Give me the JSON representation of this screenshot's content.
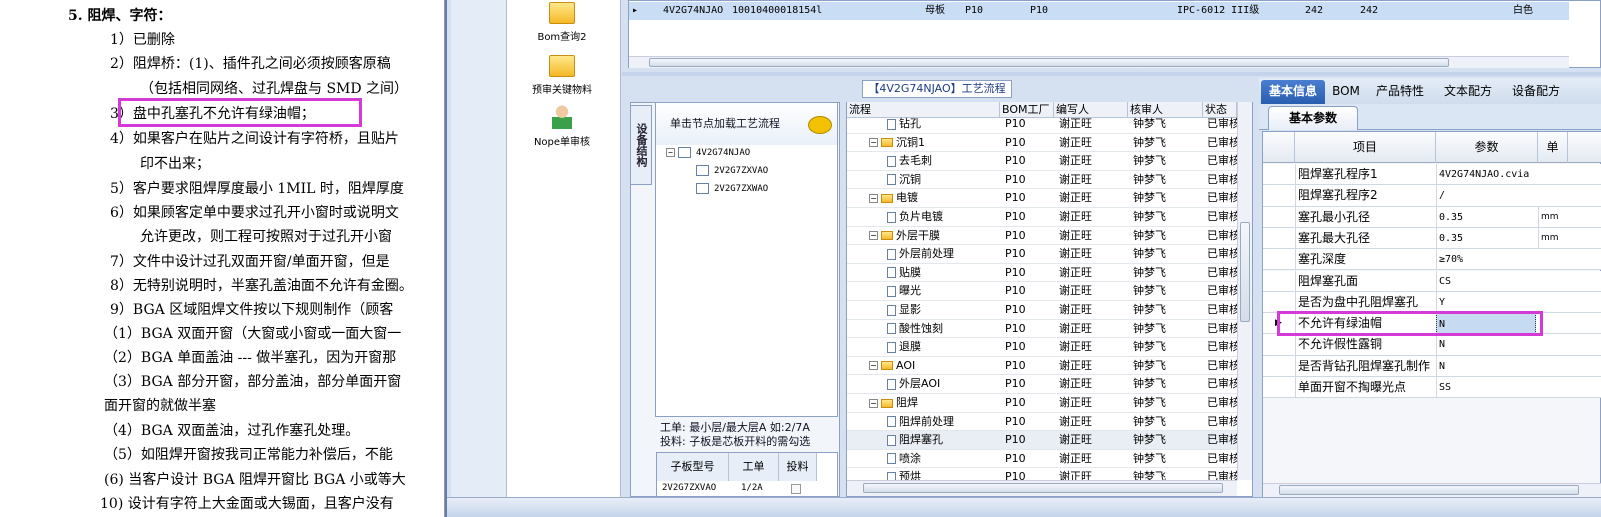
{
  "document": {
    "lines": [
      {
        "t": "5.    阻焊、字符：",
        "b": true
      },
      {
        "t": "1）已删除"
      },
      {
        "t": "2）阻焊桥：(1)、插件孔之间必须按顾客原稿"
      },
      {
        "t": "（包括相同网络、过孔焊盘与 SMD 之间）"
      },
      {
        "t": "3）盘中孔塞孔不允许有绿油帽；"
      },
      {
        "t": "4）如果客户在贴片之间设计有字符桥，且贴片"
      },
      {
        "t": "印不出来；"
      },
      {
        "t": "5）客户要求阻焊厚度最小 1MIL 时，阻焊厚度"
      },
      {
        "t": "6）如果顾客定单中要求过孔开小窗时或说明文"
      },
      {
        "t": "允许更改，则工程可按照对于过孔开小窗"
      },
      {
        "t": "7）文件中设计过孔双面开窗/单面开窗，但是"
      },
      {
        "t": "8）无特别说明时，半塞孔盖油面不允许有金圈。"
      },
      {
        "t": "9）BGA 区域阻焊文件按以下规则制作（顾客"
      },
      {
        "t": "（1）BGA 双面开窗（大窗或小窗或一面大窗一"
      },
      {
        "t": "（2）BGA 单面盖油 --- 做半塞孔，因为开窗那"
      },
      {
        "t": "（3）BGA 部分开窗，部分盖油，部分单面开窗"
      },
      {
        "t": "面开窗的就做半塞"
      },
      {
        "t": "（4）BGA 双面盖油，过孔作塞孔处理。"
      },
      {
        "t": "（5）如阻焊开窗按我司正常能力补偿后，不能"
      },
      {
        "t": "(6) 当客户设计 BGA 阻焊开窗比 BGA 小或等大"
      },
      {
        "t": "10) 设计有字符上大金面或大锡面，且客户没有"
      }
    ]
  },
  "tools": {
    "bom_query": "Bom查询2",
    "precheck": "预审关键物料",
    "nope_review": "Nope单审核"
  },
  "top_grid": {
    "row": {
      "part_no": "4V2G74NJAO",
      "code": "10010400018154l",
      "type": "母板",
      "factory": "P10",
      "factory2": "P10",
      "grade": "IPC-6012 III级",
      "a": "242",
      "b": "242",
      "color": "白色"
    }
  },
  "process_title": "【4V2G74NJAO】工艺流程",
  "left_panel": {
    "vtab": "设备结构",
    "tree_header": "单击节点加载工艺流程",
    "root": "4V2G74NJAO",
    "children": [
      "2V2G7ZXVAO",
      "2V2G7ZXWAO"
    ],
    "info1": "工单: 最小层/最大层A 如:2/7A",
    "info2": "投料: 子板是芯板开料的需勾选",
    "sub_headers": [
      "子板型号",
      "工单",
      "投料"
    ],
    "sub_row": [
      "2V2G7ZXVAO",
      "1/2A"
    ]
  },
  "process_grid": {
    "headers": [
      "流程",
      "BOM工厂",
      "编写人",
      "核审人",
      "状态"
    ],
    "rows": [
      {
        "lvl": 2,
        "name": "钻孔",
        "f": "P10",
        "w": "谢正旺",
        "r": "钟梦飞",
        "s": "已审核"
      },
      {
        "lvl": 1,
        "name": "沉铜1",
        "f": "P10",
        "w": "谢正旺",
        "r": "钟梦飞",
        "s": "已审核"
      },
      {
        "lvl": 2,
        "name": "去毛刺",
        "f": "P10",
        "w": "谢正旺",
        "r": "钟梦飞",
        "s": "已审核"
      },
      {
        "lvl": 2,
        "name": "沉铜",
        "f": "P10",
        "w": "谢正旺",
        "r": "钟梦飞",
        "s": "已审核"
      },
      {
        "lvl": 1,
        "name": "电镀",
        "f": "P10",
        "w": "谢正旺",
        "r": "钟梦飞",
        "s": "已审核"
      },
      {
        "lvl": 2,
        "name": "负片电镀",
        "f": "P10",
        "w": "谢正旺",
        "r": "钟梦飞",
        "s": "已审核"
      },
      {
        "lvl": 1,
        "name": "外层干膜",
        "f": "P10",
        "w": "谢正旺",
        "r": "钟梦飞",
        "s": "已审核"
      },
      {
        "lvl": 2,
        "name": "外层前处理",
        "f": "P10",
        "w": "谢正旺",
        "r": "钟梦飞",
        "s": "已审核"
      },
      {
        "lvl": 2,
        "name": "贴膜",
        "f": "P10",
        "w": "谢正旺",
        "r": "钟梦飞",
        "s": "已审核"
      },
      {
        "lvl": 2,
        "name": "曝光",
        "f": "P10",
        "w": "谢正旺",
        "r": "钟梦飞",
        "s": "已审核"
      },
      {
        "lvl": 2,
        "name": "显影",
        "f": "P10",
        "w": "谢正旺",
        "r": "钟梦飞",
        "s": "已审核"
      },
      {
        "lvl": 2,
        "name": "酸性蚀刻",
        "f": "P10",
        "w": "谢正旺",
        "r": "钟梦飞",
        "s": "已审核"
      },
      {
        "lvl": 2,
        "name": "退膜",
        "f": "P10",
        "w": "谢正旺",
        "r": "钟梦飞",
        "s": "已审核"
      },
      {
        "lvl": 1,
        "name": "AOI",
        "f": "P10",
        "w": "谢正旺",
        "r": "钟梦飞",
        "s": "已审核"
      },
      {
        "lvl": 2,
        "name": "外层AOI",
        "f": "P10",
        "w": "谢正旺",
        "r": "钟梦飞",
        "s": "已审核"
      },
      {
        "lvl": 1,
        "name": "阻焊",
        "f": "P10",
        "w": "谢正旺",
        "r": "钟梦飞",
        "s": "已审核"
      },
      {
        "lvl": 2,
        "name": "阻焊前处理",
        "f": "P10",
        "w": "谢正旺",
        "r": "钟梦飞",
        "s": "已审核"
      },
      {
        "lvl": 2,
        "name": "阻焊塞孔",
        "f": "P10",
        "w": "谢正旺",
        "r": "钟梦飞",
        "s": "已审核",
        "sel": true
      },
      {
        "lvl": 2,
        "name": "喷涂",
        "f": "P10",
        "w": "谢正旺",
        "r": "钟梦飞",
        "s": "已审核"
      },
      {
        "lvl": 2,
        "name": "预烘",
        "f": "P10",
        "w": "谢正旺",
        "r": "钟梦飞",
        "s": "已审核"
      }
    ]
  },
  "right_panel": {
    "tabs": [
      "基本信息",
      "BOM",
      "产品特性",
      "文本配方",
      "设备配方"
    ],
    "subtab": "基本参数",
    "headers": [
      "项目",
      "参数",
      "单"
    ],
    "rows": [
      {
        "k": "阻焊塞孔程序1",
        "v": "4V2G74NJAO.cvia",
        "u": ""
      },
      {
        "k": "阻焊塞孔程序2",
        "v": "/",
        "u": ""
      },
      {
        "k": "塞孔最小孔径",
        "v": "0.35",
        "u": "mm"
      },
      {
        "k": "塞孔最大孔径",
        "v": "0.35",
        "u": "mm"
      },
      {
        "k": "塞孔深度",
        "v": "≥70%",
        "u": ""
      },
      {
        "k": "阻焊塞孔面",
        "v": "CS",
        "u": ""
      },
      {
        "k": "是否为盘中孔阻焊塞孔",
        "v": "Y",
        "u": ""
      },
      {
        "k": "不允许有绿油帽",
        "v": "N",
        "u": "",
        "cur": true
      },
      {
        "k": "不允许假性露铜",
        "v": "N",
        "u": ""
      },
      {
        "k": "是否背钻孔阻焊塞孔制作",
        "v": "N",
        "u": ""
      },
      {
        "k": "单面开窗不掏曝光点",
        "v": "SS",
        "u": ""
      }
    ]
  },
  "colors": {
    "highlight": "#d63ad6",
    "accent": "#2a5db0"
  }
}
